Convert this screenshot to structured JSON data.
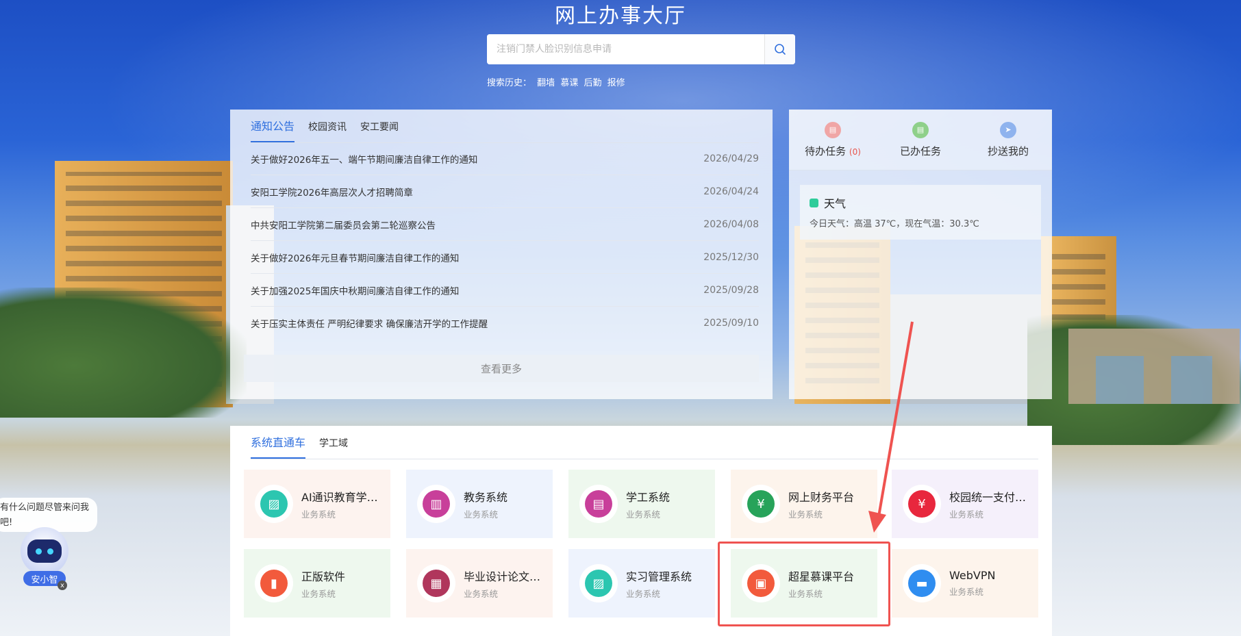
{
  "header": {
    "title": "网上办事大厅",
    "search_placeholder": "注销门禁人脸识别信息申请",
    "history_label": "搜索历史：",
    "history_items": [
      "翻墙",
      "慕课",
      "后勤",
      "报修"
    ]
  },
  "notice": {
    "tabs": [
      "通知公告",
      "校园资讯",
      "安工要闻"
    ],
    "items": [
      {
        "title": "关于做好2026年五一、端午节期间廉洁自律工作的通知",
        "date": "2026/04/29"
      },
      {
        "title": "安阳工学院2026年高层次人才招聘简章",
        "date": "2026/04/24"
      },
      {
        "title": "中共安阳工学院第二届委员会第二轮巡察公告",
        "date": "2026/04/08"
      },
      {
        "title": "关于做好2026年元旦春节期间廉洁自律工作的通知",
        "date": "2025/12/30"
      },
      {
        "title": "关于加强2025年国庆中秋期间廉洁自律工作的通知",
        "date": "2025/09/28"
      },
      {
        "title": "关于压实主体责任 严明纪律要求 确保廉洁开学的工作提醒",
        "date": "2025/09/10"
      }
    ],
    "more_label": "查看更多"
  },
  "tasks": {
    "pending_label": "待办任务",
    "pending_count": "(0)",
    "done_label": "已办任务",
    "cc_label": "抄送我的"
  },
  "weather": {
    "title": "天气",
    "detail": "今日天气：高温 37℃，现在气温：30.3℃"
  },
  "systems": {
    "tabs": [
      "系统直通车",
      "学工域"
    ],
    "cards": [
      {
        "name": "AI通识教育学…",
        "sub": "业务系统"
      },
      {
        "name": "教务系统",
        "sub": "业务系统"
      },
      {
        "name": "学工系统",
        "sub": "业务系统"
      },
      {
        "name": "网上财务平台",
        "sub": "业务系统"
      },
      {
        "name": "校园统一支付…",
        "sub": "业务系统"
      },
      {
        "name": "正版软件",
        "sub": "业务系统"
      },
      {
        "name": "毕业设计论文…",
        "sub": "业务系统"
      },
      {
        "name": "实习管理系统",
        "sub": "业务系统"
      },
      {
        "name": "超星慕课平台",
        "sub": "业务系统"
      },
      {
        "name": "WebVPN",
        "sub": "业务系统"
      }
    ]
  },
  "assistant": {
    "bubble": "有什么问题尽管来问我吧!",
    "name": "安小智",
    "close": "x"
  },
  "colors": {
    "accent": "#2f6fde",
    "highlight": "#ef5350"
  }
}
